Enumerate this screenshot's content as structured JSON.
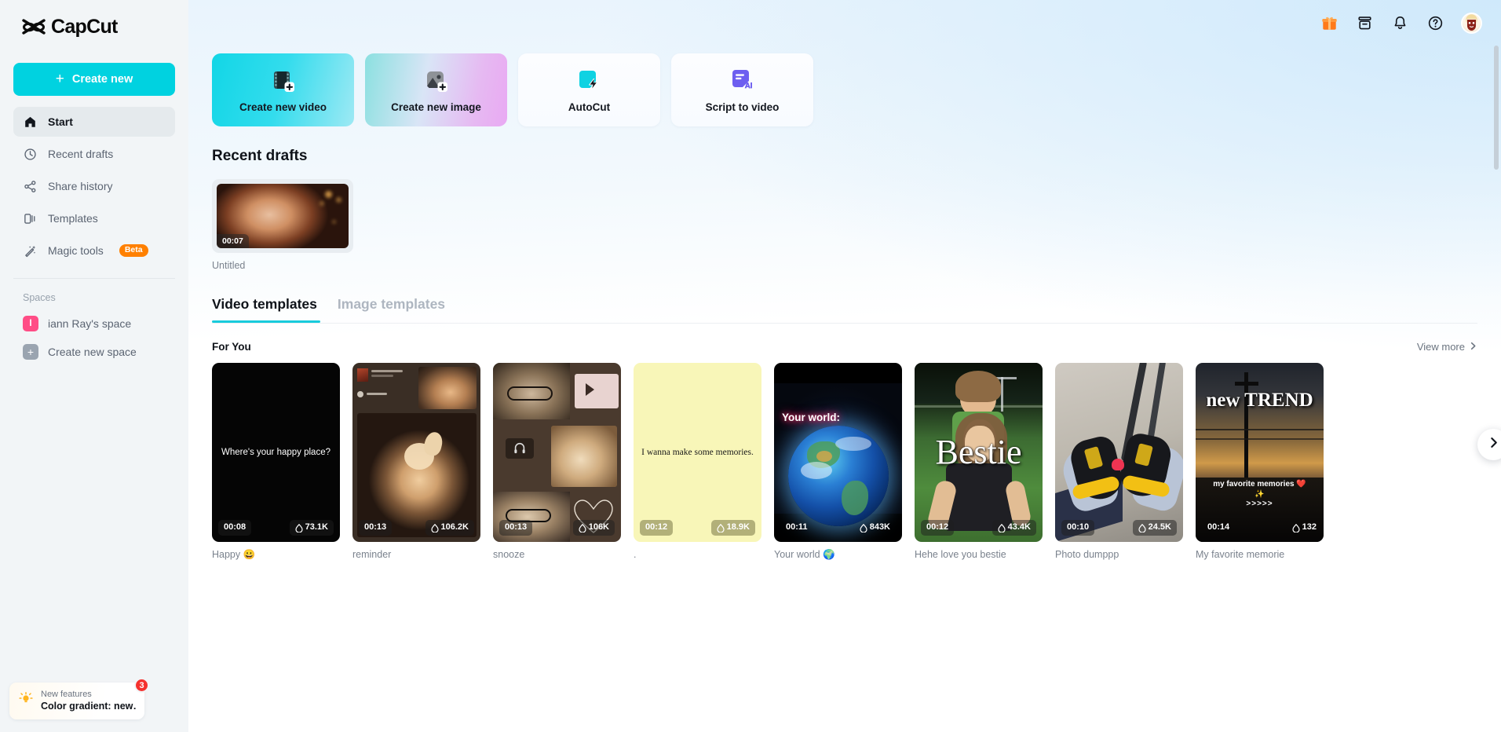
{
  "brand": {
    "name": "CapCut",
    "accent": "#00d2e0"
  },
  "sidebar": {
    "create_new_label": "Create new",
    "nav": [
      {
        "label": "Start",
        "icon": "home-icon",
        "active": true
      },
      {
        "label": "Recent drafts",
        "icon": "clock-icon",
        "active": false
      },
      {
        "label": "Share history",
        "icon": "share-icon",
        "active": false
      },
      {
        "label": "Templates",
        "icon": "templates-icon",
        "active": false
      },
      {
        "label": "Magic tools",
        "icon": "magic-wand-icon",
        "badge": "Beta",
        "active": false
      }
    ],
    "spaces_label": "Spaces",
    "spaces": [
      {
        "label": "iann Ray's space",
        "initial": "I",
        "color": "#ff4d86"
      },
      {
        "label": "Create new space",
        "initial": "+",
        "color": "#9aa4b0"
      }
    ],
    "promo": {
      "title": "New features",
      "subtitle": "Color gradient: new…",
      "badge_count": "3"
    }
  },
  "topbar": {
    "icons": [
      "gift-icon",
      "archive-icon",
      "bell-icon",
      "help-icon"
    ],
    "avatar": "user-avatar"
  },
  "actions": [
    {
      "label": "Create new video",
      "icon": "film-plus-icon",
      "style": "video"
    },
    {
      "label": "Create new image",
      "icon": "image-plus-icon",
      "style": "image"
    },
    {
      "label": "AutoCut",
      "icon": "autocut-icon",
      "style": "plain"
    },
    {
      "label": "Script to video",
      "icon": "script-ai-icon",
      "style": "plain"
    }
  ],
  "recent_drafts": {
    "title": "Recent drafts",
    "items": [
      {
        "name": "Untitled",
        "duration": "00:07"
      }
    ]
  },
  "tabs": [
    {
      "label": "Video templates",
      "active": true
    },
    {
      "label": "Image templates",
      "active": false
    }
  ],
  "for_you": {
    "title": "For You",
    "view_more": "View more",
    "next_arrow": "chevron-right-icon"
  },
  "templates": [
    {
      "name": "Happy 😀",
      "duration": "00:08",
      "views": "73.1K",
      "caption": "Where's your happy place?",
      "theme": "black-text"
    },
    {
      "name": "reminder",
      "duration": "00:13",
      "views": "106.2K",
      "caption": "",
      "theme": "cat-collage"
    },
    {
      "name": "snooze",
      "duration": "00:13",
      "views": "106K",
      "caption": "",
      "theme": "dog-collage"
    },
    {
      "name": ".",
      "duration": "00:12",
      "views": "18.9K",
      "caption": "I wanna make some memories.",
      "theme": "yellow-note"
    },
    {
      "name": "Your world 🌍",
      "duration": "00:11",
      "views": "843K",
      "caption": "Your world:",
      "theme": "earth"
    },
    {
      "name": "Hehe love you bestie",
      "duration": "00:12",
      "views": "43.4K",
      "caption": "Bestie",
      "theme": "field-photo"
    },
    {
      "name": "Photo dumppp",
      "duration": "00:10",
      "views": "24.5K",
      "caption": "",
      "theme": "shoes"
    },
    {
      "name": "My favorite memorie",
      "duration": "00:14",
      "views": "132",
      "caption": "new TREND",
      "caption2": "my favorite memories ❤️✨",
      "caption3": ">>>>>",
      "theme": "sunset"
    }
  ]
}
